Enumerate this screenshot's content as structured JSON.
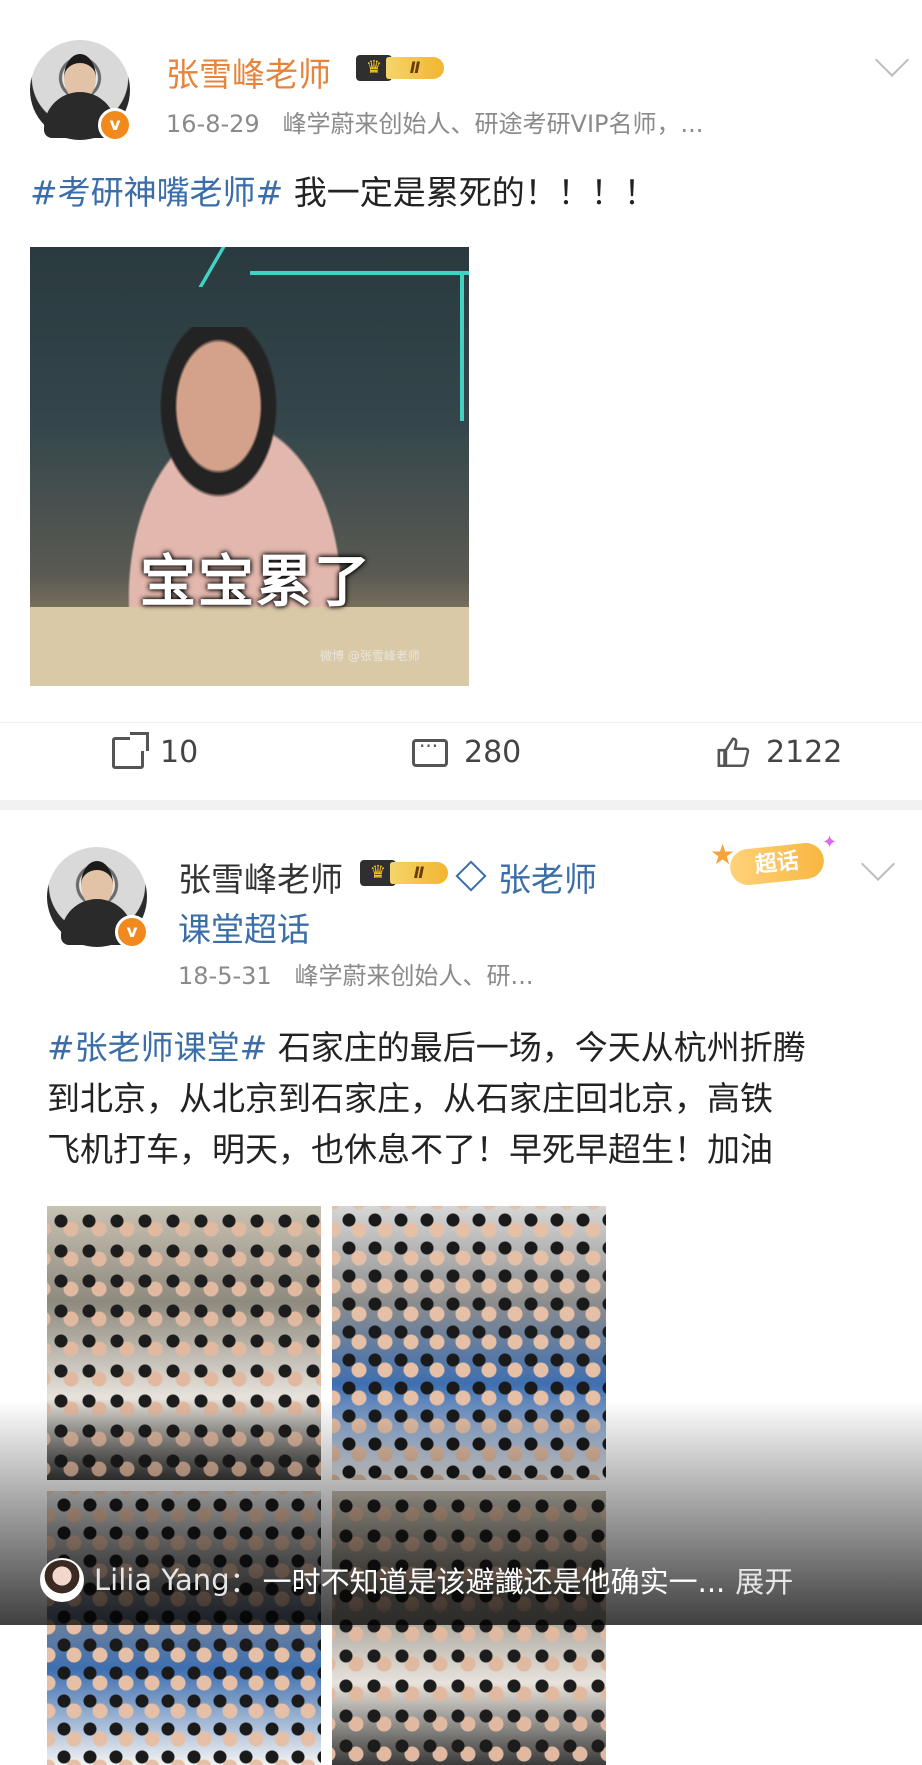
{
  "post1": {
    "name": "张雪峰老师",
    "vip_level": "Ⅱ",
    "date": "16-8-29",
    "bio": "峰学蔚来创始人、研途考研VIP名师，...",
    "hashtag": "#考研神嘴老师#",
    "text": " 我一定是累死的！！！！",
    "image_caption": "宝宝累了",
    "image_watermark": "微博 @张雪峰老师",
    "share_count": "10",
    "comment_count": "280",
    "like_count": "2122"
  },
  "post2": {
    "name": "张雪峰老师",
    "vip_level": "Ⅱ",
    "topic_line1": "张老师",
    "topic_line2": "课堂超话",
    "chaohua_badge": "超话",
    "date": "18-5-31",
    "bio": "峰学蔚来创始人、研...",
    "hashtag": "#张老师课堂#",
    "text_line1": " 石家庄的最后一场，今天从杭州折腾",
    "text_line2": "到北京，从北京到石家庄，从石家庄回北京，高铁",
    "text_line3": "飞机打车，明天，也休息不了！早死早超生！加油"
  },
  "comment_overlay": {
    "user": "Lilia Yang",
    "separator": "：",
    "text": "一时不知道是该避讖还是他确实一...",
    "expand_label": "展开"
  },
  "colors": {
    "name_orange": "#e8833a",
    "link_blue": "#3b6ea8",
    "meta_gray": "#8a8a8a"
  }
}
